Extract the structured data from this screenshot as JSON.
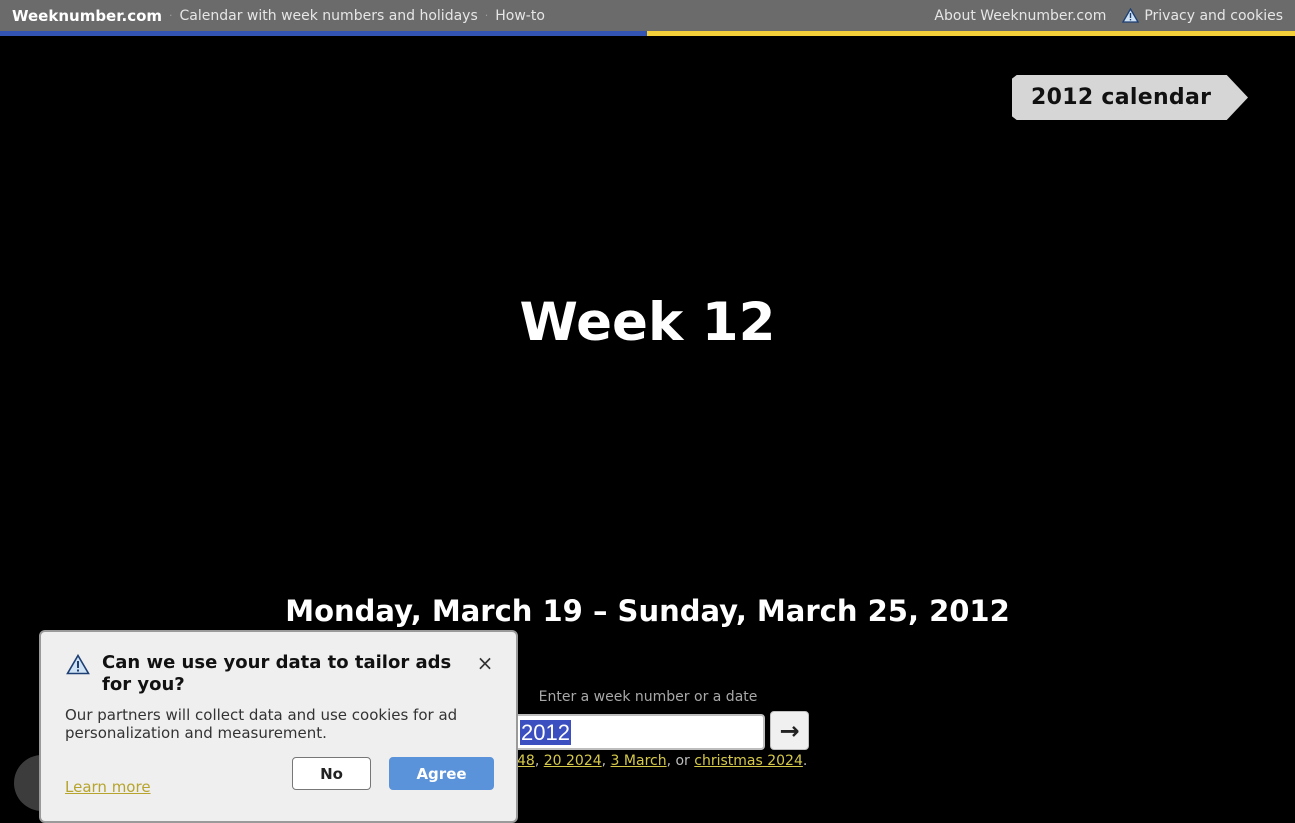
{
  "topbar": {
    "brand": "Weeknumber.com",
    "nav": [
      {
        "label": "Calendar with week numbers and holidays"
      },
      {
        "label": "How-to"
      }
    ],
    "about": "About Weeknumber.com",
    "privacy": "Privacy and cookies",
    "privacy_icon": "warning-triangle-icon",
    "stripe_colors": [
      "#3454b4",
      "#f4d03a"
    ]
  },
  "year_tag": {
    "label": "2012 calendar"
  },
  "main": {
    "week_heading": "Week 12",
    "date_range": "Monday, March 19 – Sunday, March 25, 2012"
  },
  "search": {
    "label": "Enter a week number or a date",
    "value": "2012",
    "go_icon": "arrow-right-icon",
    "go_label": "→",
    "examples": {
      "links": [
        "48",
        "20 2024",
        "3 March",
        "christmas 2024"
      ],
      "sep1": ", ",
      "sep2": ", ",
      "sep3": ", or ",
      "end": "."
    }
  },
  "cookie_dialog": {
    "icon": "warning-triangle-icon",
    "title": "Can we use your data to tailor ads for you?",
    "close_label": "×",
    "body": "Our partners will collect data and use cookies for ad personalization and measurement.",
    "learn_more": "Learn more",
    "no_label": "No",
    "agree_label": "Agree",
    "agree_color": "#5b93db"
  }
}
